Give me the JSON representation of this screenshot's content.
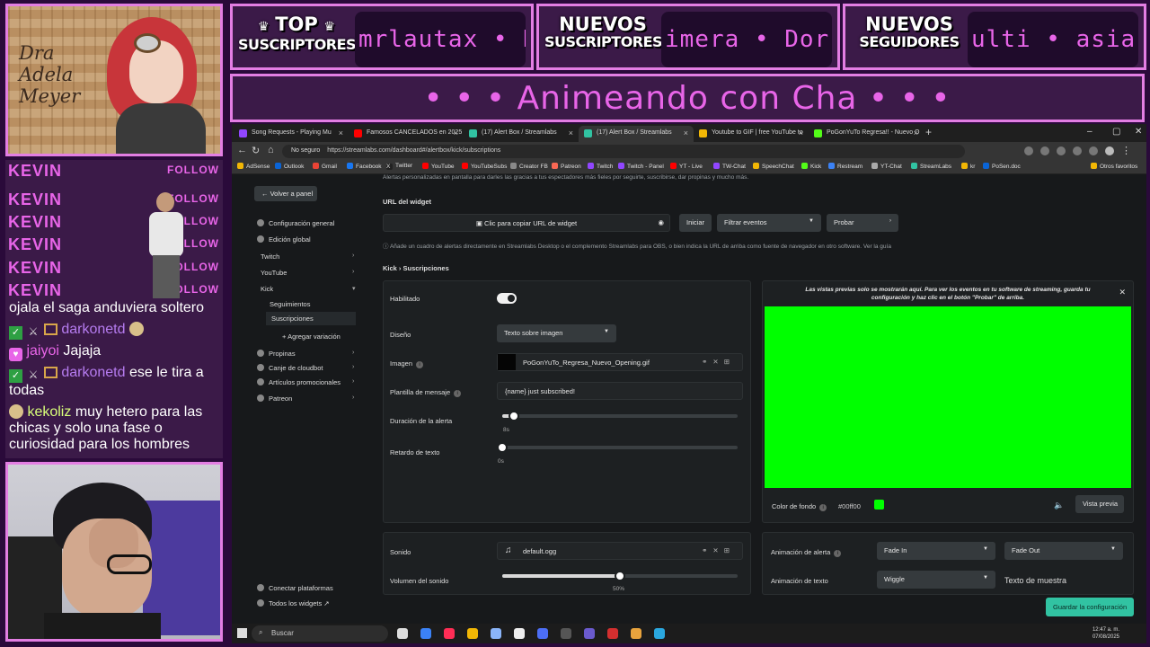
{
  "overlay": {
    "avatar_name": "Dra Adela Meyer",
    "follow_name": "KEVIN",
    "follow_label": "FOLLOW",
    "banners": [
      {
        "line1": "TOP",
        "line2": "SUSCRIPTORES",
        "ticker": "mrlautax • K"
      },
      {
        "line1": "NUEVOS",
        "line2": "SUSCRIPTORES",
        "ticker": "imera • Dor"
      },
      {
        "line1": "NUEVOS",
        "line2": "SEGUIDORES",
        "ticker": "ulti • asia"
      }
    ],
    "title": "• • • Animeando con Cha • • •",
    "chat": [
      {
        "user": "",
        "text": "ojala el saga anduviera soltero"
      },
      {
        "user": "darkonetd",
        "text": ""
      },
      {
        "user": "jaiyoi",
        "text": "Jajaja"
      },
      {
        "user": "darkonetd",
        "text": "ese le tira a todas"
      },
      {
        "user": "kekoliz",
        "text": "muy hetero para las chicas y solo una fase o curiosidad para los hombres"
      }
    ]
  },
  "browser": {
    "tabs": [
      {
        "label": "Song Requests - Playing Mu",
        "color": "#9146ff"
      },
      {
        "label": "Famosos CANCELADOS en 2025",
        "color": "#ff0000"
      },
      {
        "label": "(17) Alert Box / Streamlabs",
        "color": "#31c3a2"
      },
      {
        "label": "(17) Alert Box / Streamlabs",
        "color": "#31c3a2"
      },
      {
        "label": "Youtube to GIF | free YouTube to",
        "color": "#f2b705"
      },
      {
        "label": "PoGonYuTo Regresa!! - Nuevo O",
        "color": "#53fc18"
      }
    ],
    "url_secure": "No seguro",
    "url": "https://streamlabs.com/dashboard#/alertbox/kick/subscriptions",
    "bookmarks": [
      "AdSense",
      "Outlook",
      "Gmail",
      "Facebook",
      "Twitter",
      "YouTube",
      "YouTubeSubs",
      "Creator FB",
      "Patreon",
      "Twitch",
      "Twitch - Panel",
      "YT - Live",
      "TW-Chat",
      "SpeechChat",
      "Kick",
      "Restream",
      "YT-Chat",
      "StreamLabs",
      "kr",
      "PoSen.doc"
    ],
    "bookmarks_other": "Otros favoritos"
  },
  "sidenav": {
    "back": "Volver a panel",
    "items": [
      "Configuración general",
      "Edición global",
      "Twitch",
      "YouTube",
      "Kick",
      "Seguimientos",
      "Suscripciones",
      "Agregar variación",
      "Propinas",
      "Canje de cloudbot",
      "Artículos promocionales",
      "Patreon"
    ],
    "bottom": [
      "Conectar plataformas",
      "Todos los widgets"
    ]
  },
  "content": {
    "hint_top": "Alertas personalizadas en pantalla para darles las gracias a tus espectadores más fieles por seguirte, suscribirse, dar propinas y mucho más.",
    "widget_url_label": "URL del widget",
    "copy_url": "Clic para copiar URL de widget",
    "start_btn": "Iniciar",
    "filter_btn": "Filtrar eventos",
    "test_btn": "Probar",
    "widget_hint": "Añade un cuadro de alertas directamente en Streamlabs Desktop o el complemento Streamlabs para OBS, o bien indica la URL de arriba como fuente de navegador en otro software. Ver la guía",
    "section_title": "Kick › Suscripciones",
    "enabled_label": "Habilitado",
    "design_label": "Diseño",
    "design_value": "Texto sobre imagen",
    "image_label": "Imagen",
    "image_value": "PoGonYuTo_Regresa_Nuevo_Opening.gif",
    "template_label": "Plantilla de mensaje",
    "template_value": "{name} just subscribed!",
    "duration_label": "Duración de la alerta",
    "duration_value": "8s",
    "duration_fraction": 0.05,
    "delay_label": "Retardo de texto",
    "delay_value": "0s",
    "delay_fraction": 0.0,
    "preview_note": "Las vistas previas solo se mostrarán aquí. Para ver los eventos en tu software de streaming, guarda tu configuración y haz clic en el botón \"Probar\" de arriba.",
    "bg_color_label": "Color de fondo",
    "bg_color_value": "#00ff00",
    "preview_btn": "Vista previa",
    "sound_label": "Sonido",
    "sound_value": "default.ogg",
    "volume_label": "Volumen del sonido",
    "volume_value": "50%",
    "volume_fraction": 0.5,
    "anim_label": "Animación de alerta",
    "anim_in": "Fade In",
    "anim_out": "Fade Out",
    "text_anim_label": "Animación de texto",
    "text_anim_value": "Wiggle",
    "text_sample": "Texto de muestra",
    "save_btn": "Guardar la configuración",
    "green_color": "#00ff00"
  },
  "taskbar": {
    "search": "Buscar",
    "time": "12:47 a. m.",
    "date": "07/08/2025"
  }
}
